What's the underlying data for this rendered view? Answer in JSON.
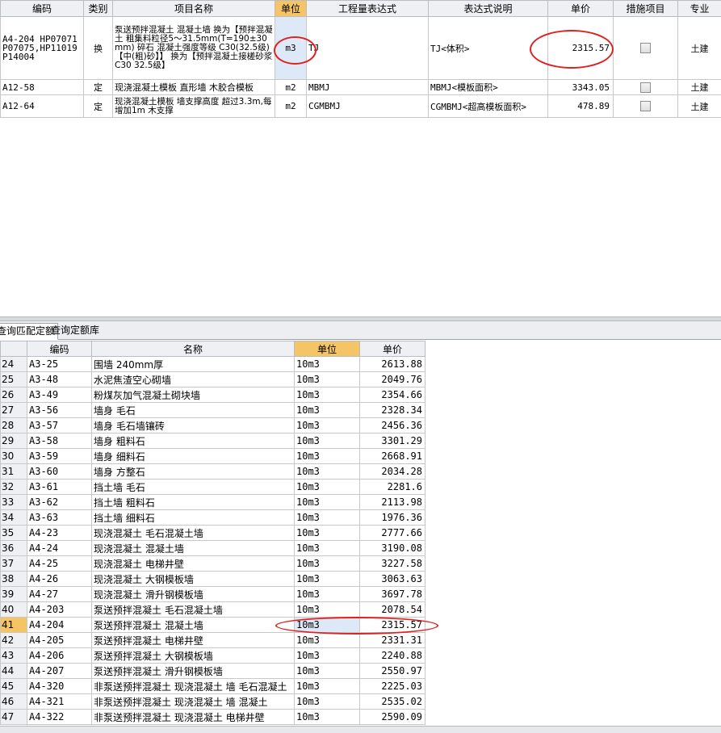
{
  "top_grid": {
    "headers": [
      "编码",
      "类别",
      "项目名称",
      "单位",
      "工程量表达式",
      "表达式说明",
      "单价",
      "措施项目",
      "专业"
    ],
    "rows": [
      {
        "code": "A4-204 HP07071 P07075,HP11019 P14004",
        "type": "换",
        "name": "泵送预拌混凝土 混凝土墙 换为【预拌混凝土 粗集料粒径5～31.5mm(T=190±30mm) 碎石 混凝土强度等级 C30(32.5级)【中(粗)砂】】 换为【预拌混凝土接槎砂浆 C30 32.5级】",
        "unit": "m3",
        "expr": "TJ",
        "desc": "TJ<体积>",
        "price": "2315.57",
        "measure": false,
        "major": "土建"
      },
      {
        "code": "A12-58",
        "type": "定",
        "name": "现浇混凝土模板 直形墙 木胶合模板",
        "unit": "m2",
        "expr": "MBMJ",
        "desc": "MBMJ<模板面积>",
        "price": "3343.05",
        "measure": false,
        "major": "土建"
      },
      {
        "code": "A12-64",
        "type": "定",
        "name": "现浇混凝土模板 墙支撑高度 超过3.3m,每增加1m 木支撑",
        "unit": "m2",
        "expr": "CGMBMJ",
        "desc": "CGMBMJ<超高模板面积>",
        "price": "478.89",
        "measure": false,
        "major": "土建"
      }
    ]
  },
  "tabs": {
    "match": "查询匹配定额",
    "query": "查询定额库"
  },
  "bottom_grid": {
    "headers": [
      "",
      "编码",
      "名称",
      "单位",
      "单价"
    ],
    "current_index": "41",
    "rows": [
      {
        "idx": "24",
        "code": "A3-25",
        "name": "围墙 240mm厚",
        "unit": "10m3",
        "price": "2613.88"
      },
      {
        "idx": "25",
        "code": "A3-48",
        "name": "水泥焦渣空心砌墙",
        "unit": "10m3",
        "price": "2049.76"
      },
      {
        "idx": "26",
        "code": "A3-49",
        "name": "粉煤灰加气混凝土砌块墙",
        "unit": "10m3",
        "price": "2354.66"
      },
      {
        "idx": "27",
        "code": "A3-56",
        "name": "墙身 毛石",
        "unit": "10m3",
        "price": "2328.34"
      },
      {
        "idx": "28",
        "code": "A3-57",
        "name": "墙身 毛石墙镶砖",
        "unit": "10m3",
        "price": "2456.36"
      },
      {
        "idx": "29",
        "code": "A3-58",
        "name": "墙身 粗料石",
        "unit": "10m3",
        "price": "3301.29"
      },
      {
        "idx": "30",
        "code": "A3-59",
        "name": "墙身 细料石",
        "unit": "10m3",
        "price": "2668.91"
      },
      {
        "idx": "31",
        "code": "A3-60",
        "name": "墙身 方整石",
        "unit": "10m3",
        "price": "2034.28"
      },
      {
        "idx": "32",
        "code": "A3-61",
        "name": "挡土墙 毛石",
        "unit": "10m3",
        "price": "2281.6"
      },
      {
        "idx": "33",
        "code": "A3-62",
        "name": "挡土墙 粗料石",
        "unit": "10m3",
        "price": "2113.98"
      },
      {
        "idx": "34",
        "code": "A3-63",
        "name": "挡土墙 细料石",
        "unit": "10m3",
        "price": "1976.36"
      },
      {
        "idx": "35",
        "code": "A4-23",
        "name": "现浇混凝土 毛石混凝土墙",
        "unit": "10m3",
        "price": "2777.66"
      },
      {
        "idx": "36",
        "code": "A4-24",
        "name": "现浇混凝土 混凝土墙",
        "unit": "10m3",
        "price": "3190.08"
      },
      {
        "idx": "37",
        "code": "A4-25",
        "name": "现浇混凝土 电梯井壁",
        "unit": "10m3",
        "price": "3227.58"
      },
      {
        "idx": "38",
        "code": "A4-26",
        "name": "现浇混凝土 大钢模板墙",
        "unit": "10m3",
        "price": "3063.63"
      },
      {
        "idx": "39",
        "code": "A4-27",
        "name": "现浇混凝土 滑升钢模板墙",
        "unit": "10m3",
        "price": "3697.78"
      },
      {
        "idx": "40",
        "code": "A4-203",
        "name": "泵送预拌混凝土 毛石混凝土墙",
        "unit": "10m3",
        "price": "2078.54"
      },
      {
        "idx": "41",
        "code": "A4-204",
        "name": "泵送预拌混凝土 混凝土墙",
        "unit": "10m3",
        "price": "2315.57"
      },
      {
        "idx": "42",
        "code": "A4-205",
        "name": "泵送预拌混凝土 电梯井壁",
        "unit": "10m3",
        "price": "2331.31"
      },
      {
        "idx": "43",
        "code": "A4-206",
        "name": "泵送预拌混凝土 大钢模板墙",
        "unit": "10m3",
        "price": "2240.88"
      },
      {
        "idx": "44",
        "code": "A4-207",
        "name": "泵送预拌混凝土 滑升钢模板墙",
        "unit": "10m3",
        "price": "2550.97"
      },
      {
        "idx": "45",
        "code": "A4-320",
        "name": "非泵送预拌混凝土 现浇混凝土 墙 毛石混凝土",
        "unit": "10m3",
        "price": "2225.03"
      },
      {
        "idx": "46",
        "code": "A4-321",
        "name": "非泵送预拌混凝土 现浇混凝土 墙 混凝土",
        "unit": "10m3",
        "price": "2535.02"
      },
      {
        "idx": "47",
        "code": "A4-322",
        "name": "非泵送预拌混凝土 现浇混凝土 电梯井壁",
        "unit": "10m3",
        "price": "2590.09"
      }
    ]
  },
  "colors": {
    "selected_header": "#f5c465",
    "selected_cell": "#dde9f7",
    "annotation": "#e02020"
  }
}
